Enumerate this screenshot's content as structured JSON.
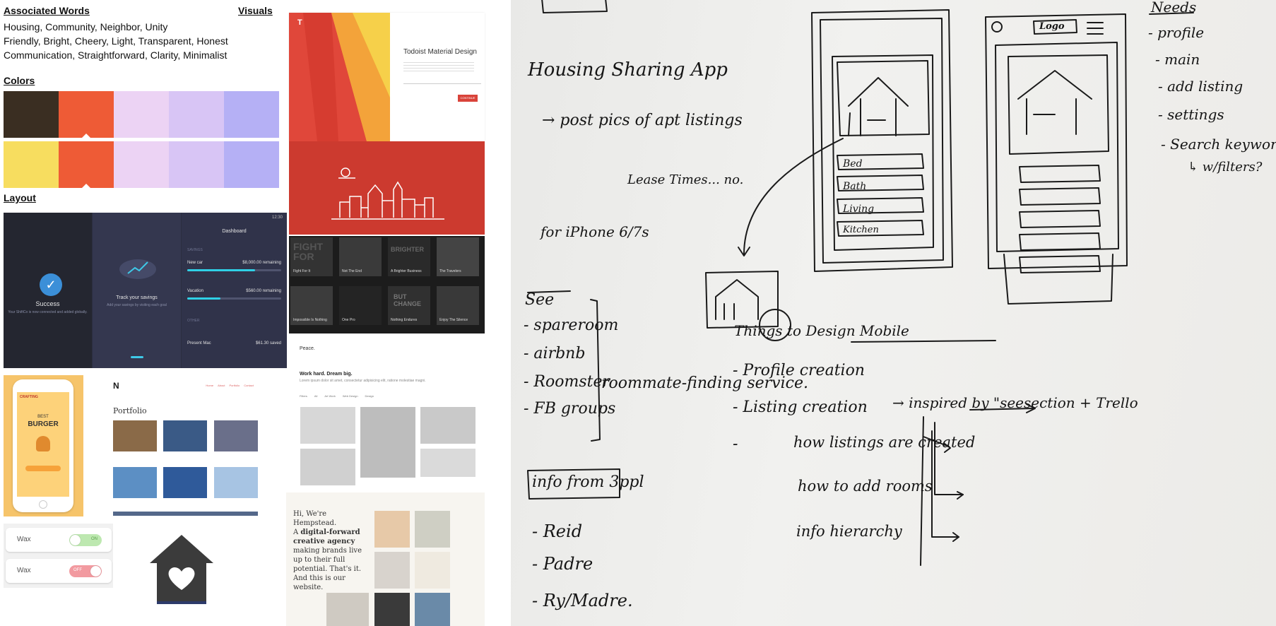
{
  "moodboard": {
    "associated_words": {
      "heading": "Associated Words",
      "lines": [
        "Housing, Community, Neighbor, Unity",
        "Friendly, Bright, Cheery, Light, Transparent, Honest",
        "Communication, Straightforward, Clarity, Minimalist"
      ]
    },
    "visuals_heading": "Visuals",
    "colors": {
      "heading": "Colors",
      "row1": [
        "#3a2e22",
        "#ee5b36",
        "#ecd3f4",
        "#d8c5f5",
        "#b5b0f5"
      ],
      "row2": [
        "#f7dd5f",
        "#ee5b36",
        "#ecd3f4",
        "#d8c5f5",
        "#b5b0f5"
      ]
    },
    "layout_heading": "Layout",
    "phone_screens": {
      "success_title": "Success",
      "success_sub": "Your ShiftCo is now connected and added globally.",
      "savings_title": "Track your savings",
      "savings_sub": "Add your savings by visiting each goal",
      "dashboard_title": "Dashboard",
      "time": "12:30",
      "savings_label": "SAVINGS",
      "goals": [
        {
          "name": "New car",
          "amount": "$8,000.00 remaining",
          "progress": 0.72
        },
        {
          "name": "Vacation",
          "amount": "$560.00 remaining",
          "progress": 0.35
        }
      ],
      "other_label": "OTHER",
      "present_name": "Present Mac",
      "present_amount": "$61.30 saved"
    },
    "todoist": {
      "logo": "T",
      "title": "Todoist Material Design",
      "button": "CONTINUE"
    },
    "films": [
      {
        "title": "Fight For It",
        "poster": "FIGHT FOR"
      },
      {
        "title": "Not The End",
        "poster": ""
      },
      {
        "title": "A Brighter Business",
        "poster": "BRIGHTER"
      },
      {
        "title": "The Travelers",
        "poster": ""
      },
      {
        "title": "Impossible Is Nothing",
        "poster": ""
      },
      {
        "title": "One Pro",
        "poster": ""
      },
      {
        "title": "Nothing Endures",
        "poster": "BUT CHANGE"
      },
      {
        "title": "Enjoy The Silence",
        "poster": ""
      }
    ],
    "burger": {
      "brand": "CRAFTING",
      "line1": "BEST",
      "line2": "BURGER"
    },
    "portfolio": {
      "logo": "N",
      "heading": "Portfolio",
      "nav": [
        "Home",
        "About",
        "Portfolio",
        "Contact"
      ]
    },
    "peace": {
      "logo": "Peace.",
      "headline": "Work hard. Dream big.",
      "body": "Lorem ipsum dolor sit amet, consectetur adipisicing elit, ratione molestiae magni.",
      "filters": [
        "Filters",
        "All",
        "Art Work",
        "Web Design",
        "Design"
      ]
    },
    "hempstead": {
      "greeting": "Hi, We're Hempstead.",
      "line_a": "A ",
      "bold": "digital-forward creative agency",
      "rest": " making brands live up to their full potential. That's it. And this is our website."
    },
    "toggles": [
      {
        "label": "Wax",
        "state": "ON",
        "on": true
      },
      {
        "label": "Wax",
        "state": "OFF",
        "on": false
      }
    ]
  },
  "sketch": {
    "app_title": "Housing Sharing App",
    "post": "→ post pics of apt listings",
    "lease": "Lease Times... no.",
    "iphone": "for iPhone 6/7s",
    "see_heading": "See",
    "see_items": [
      "- spareroom",
      "- airbnb",
      "- Roomster",
      "- FB groups"
    ],
    "roommate_note": "roommate-finding service.",
    "info_heading": "info from 3ppl",
    "info_items": [
      "- Reid",
      "- Padre",
      "- Ry/Madre."
    ],
    "needs_heading": "Needs",
    "needs_items": [
      "- profile",
      "- main",
      "- add listing",
      "- settings",
      "- Search keywords"
    ],
    "filters_note": "↳ w/filters?",
    "things_heading": "Things to Design Mobile",
    "things_items": [
      "- Profile creation",
      "- Listing creation",
      "-"
    ],
    "inspired": "→ inspired by \"seesection + Trello",
    "sub_items": [
      "how listings are created",
      "how to add rooms",
      "info hierarchy"
    ],
    "wireframe_fields": [
      "Bed",
      "Bath",
      "Living",
      "Kitchen"
    ],
    "logo_text": "Logo"
  }
}
